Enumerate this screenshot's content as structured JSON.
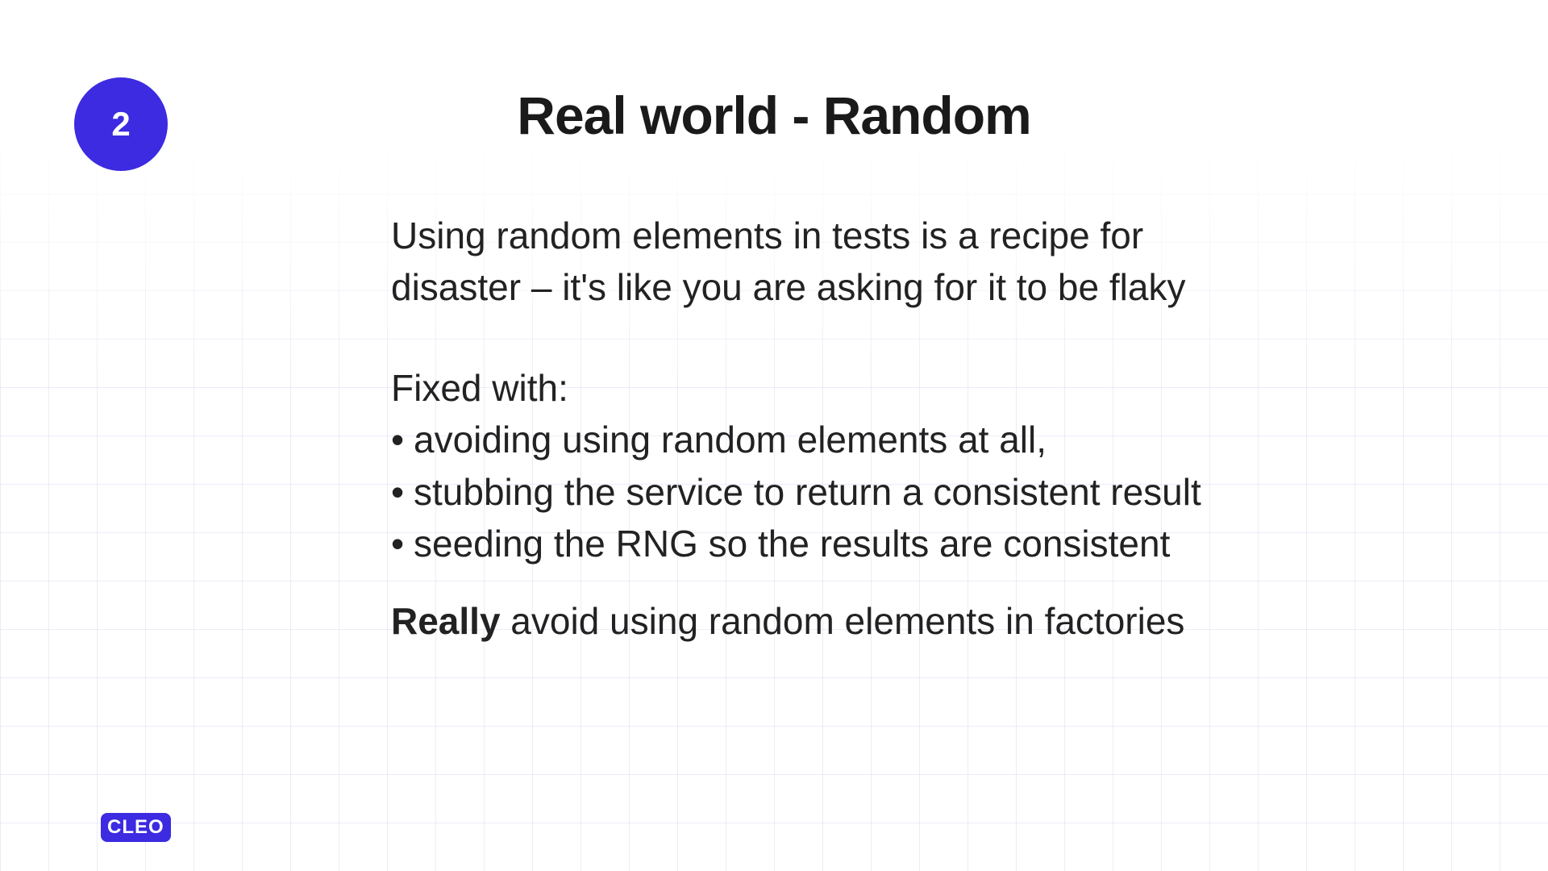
{
  "badge": {
    "number": "2"
  },
  "title": "Real world - Random",
  "intro": "Using random elements in tests is a recipe for disaster – it's like you are asking for it to  be flaky",
  "fixedLabel": "Fixed with:",
  "bullets": [
    "avoiding using random elements at all,",
    "stubbing the service to return a consistent result",
    "seeding the RNG so the results are consistent"
  ],
  "conclusion": {
    "bold": "Really",
    "rest": " avoid using random elements in factories"
  },
  "logo": "CLEO",
  "colors": {
    "accent": "#3c2be0"
  }
}
